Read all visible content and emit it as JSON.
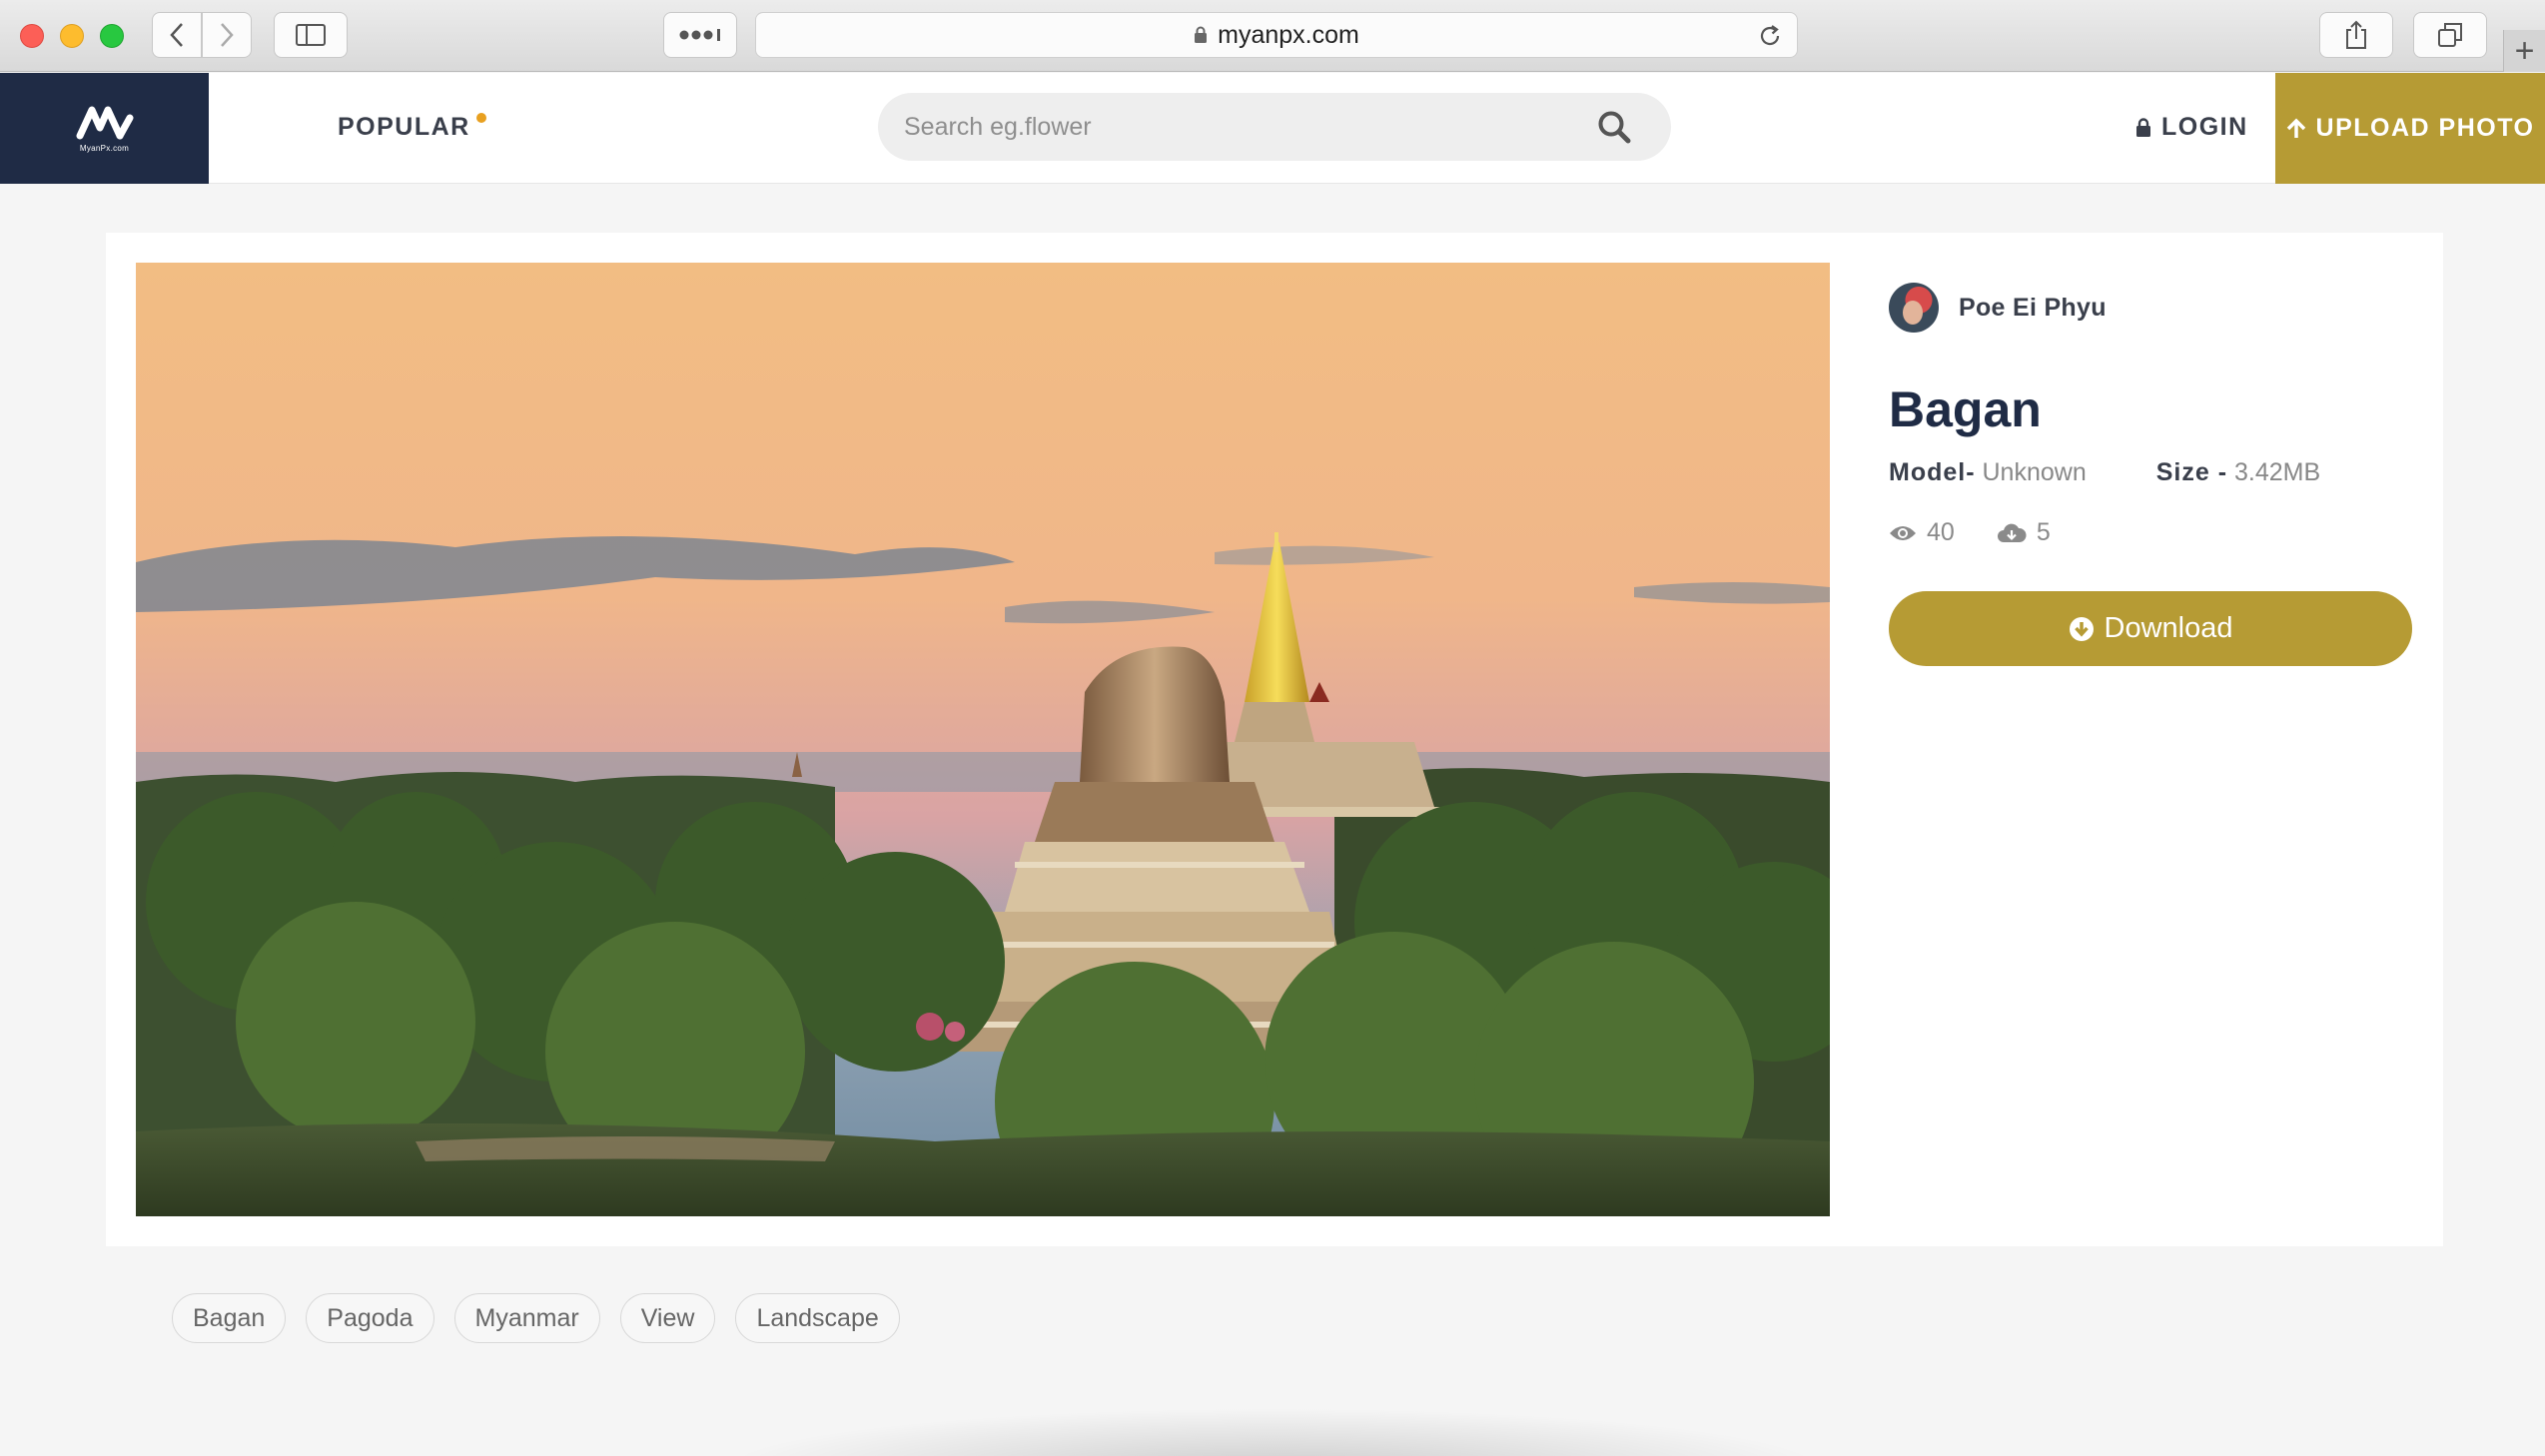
{
  "browser": {
    "url": "myanpx.com"
  },
  "header": {
    "logo_text": "MyanPx.com",
    "popular_label": "POPULAR",
    "search_placeholder": "Search eg.flower",
    "login_label": "LOGIN",
    "upload_label": "UPLOAD PHOTO",
    "accent_color": "#b69b34",
    "logo_bg": "#1f2b45"
  },
  "photo": {
    "author": "Poe Ei Phyu",
    "title": "Bagan",
    "model_label": "Model-",
    "model_value": "Unknown",
    "size_label": "Size -",
    "size_value": "3.42MB",
    "views": "40",
    "downloads": "5",
    "download_label": "Download"
  },
  "tags": [
    "Bagan",
    "Pagoda",
    "Myanmar",
    "View",
    "Landscape"
  ]
}
